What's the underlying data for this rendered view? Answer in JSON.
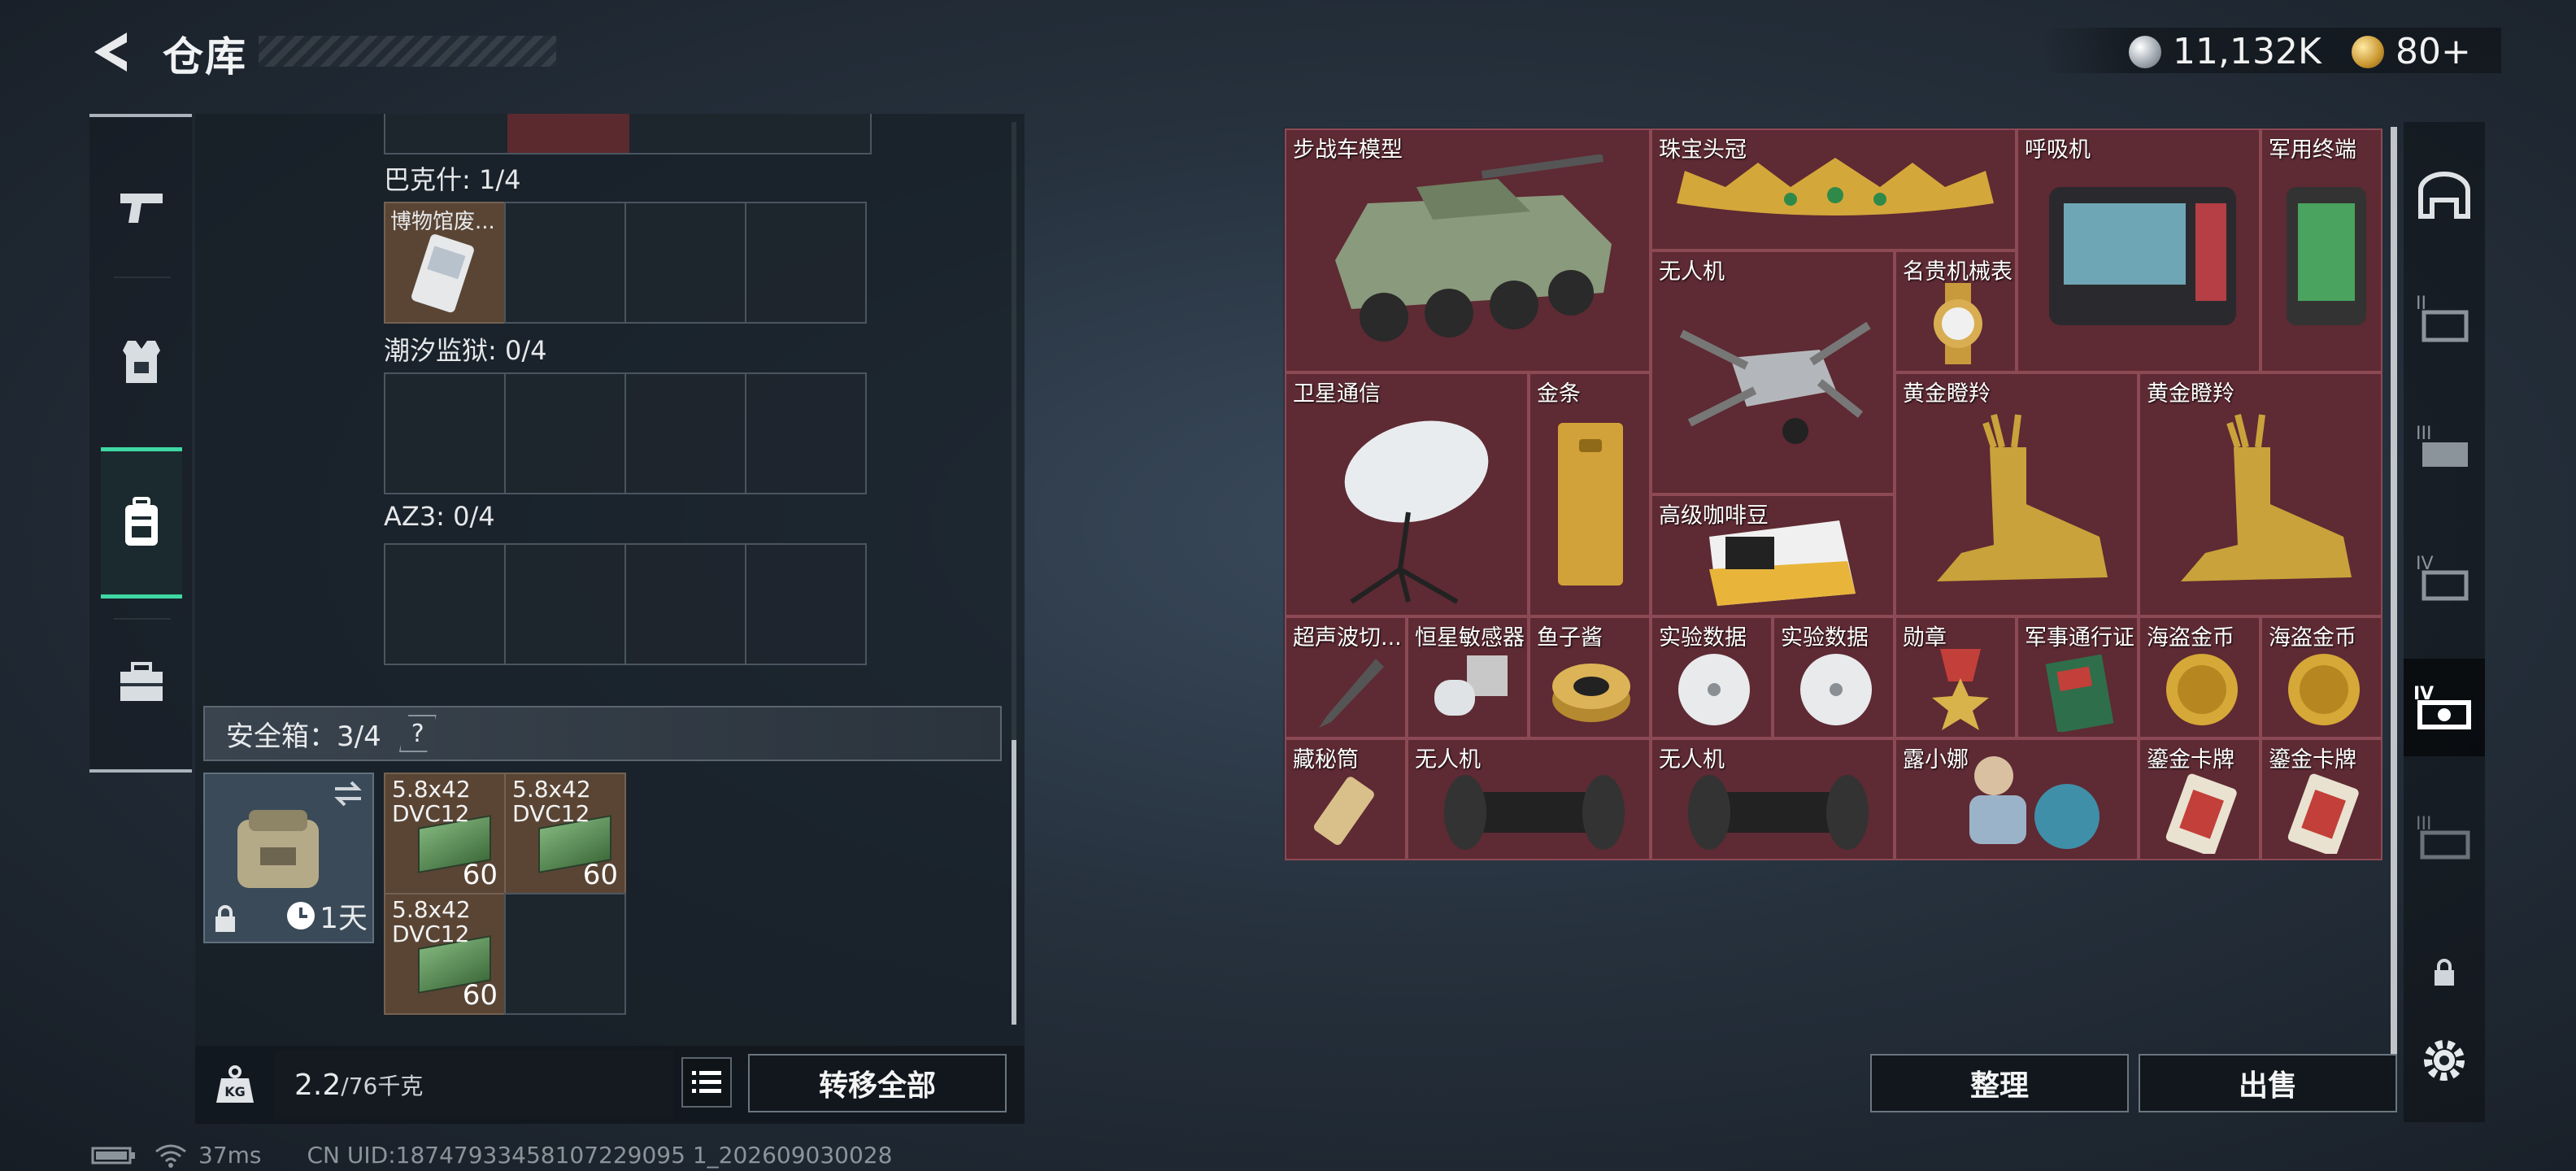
{
  "header": {
    "title": "仓库",
    "currency_silver": "11,132K",
    "currency_gold": "80+"
  },
  "left_rail": {
    "items": [
      {
        "name": "weapon",
        "icon": "pistol-icon"
      },
      {
        "name": "armor",
        "icon": "armor-vest-icon"
      },
      {
        "name": "backpack",
        "icon": "backpack-icon"
      },
      {
        "name": "medkit",
        "icon": "toolbox-icon"
      }
    ],
    "active_index": 2
  },
  "left_panel": {
    "groups": [
      {
        "label": "巴克什: 1/4",
        "item_label": "博物馆废..."
      },
      {
        "label": "潮汐监狱: 0/4"
      },
      {
        "label": "AZ3: 0/4"
      }
    ],
    "safe_box": {
      "label": "安全箱：3/4",
      "help": "?",
      "duration": "1天",
      "ammo": [
        {
          "name": "5.8x42 DVC12",
          "count": "60"
        },
        {
          "name": "5.8x42 DVC12",
          "count": "60"
        },
        {
          "name": "5.8x42 DVC12",
          "count": "60"
        }
      ]
    },
    "weight_current": "2.2",
    "weight_max": "/76千克",
    "transfer_all": "转移全部"
  },
  "right_panel": {
    "items": [
      {
        "label": "步战车模型"
      },
      {
        "label": "珠宝头冠"
      },
      {
        "label": "呼吸机"
      },
      {
        "label": "军用终端"
      },
      {
        "label": "无人机"
      },
      {
        "label": "名贵机械表"
      },
      {
        "label": "卫星通信"
      },
      {
        "label": "金条"
      },
      {
        "label": "黄金瞪羚"
      },
      {
        "label": "黄金瞪羚"
      },
      {
        "label": "高级咖啡豆"
      },
      {
        "label": "超声波切..."
      },
      {
        "label": "恒星敏感器"
      },
      {
        "label": "鱼子酱"
      },
      {
        "label": "实验数据"
      },
      {
        "label": "实验数据"
      },
      {
        "label": "勋章"
      },
      {
        "label": "军事通行证"
      },
      {
        "label": "海盗金币"
      },
      {
        "label": "海盗金币"
      },
      {
        "label": "藏秘筒"
      },
      {
        "label": "无人机"
      },
      {
        "label": "无人机"
      },
      {
        "label": "露小娜"
      },
      {
        "label": "鎏金卡牌"
      },
      {
        "label": "鎏金卡牌"
      }
    ],
    "sort": "整理",
    "sell": "出售"
  },
  "right_rail": {
    "items": [
      {
        "icon": "storage-main-icon"
      },
      {
        "icon": "storage-tier-2-icon"
      },
      {
        "icon": "storage-tier-3-icon"
      },
      {
        "icon": "storage-tier-4-icon"
      },
      {
        "icon": "storage-tier-4-b-icon"
      },
      {
        "icon": "storage-tier-3-b-icon"
      },
      {
        "icon": "lock-icon"
      },
      {
        "icon": "gear-icon"
      }
    ],
    "active_index": 4
  },
  "footer": {
    "ping": "37ms",
    "uid": "CN UID:18747933458107229095 1_202609030028"
  },
  "colors": {
    "item_bg": "#5e2a33",
    "accent_green": "#3fd8a4"
  }
}
